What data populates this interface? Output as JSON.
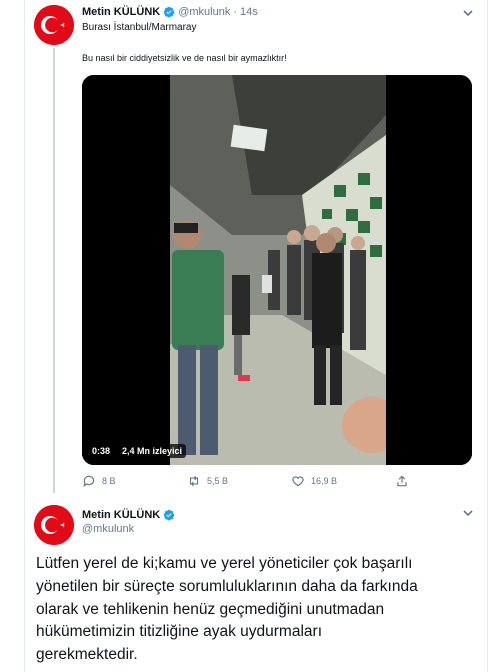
{
  "tweet1": {
    "author_name": "Metin KÜLÜNK",
    "handle": "@mkulunk",
    "separator": "·",
    "time": "14s",
    "location": "Burası İstanbul/Marmaray",
    "text": "Bu nasıl bir ciddiyetsizlik ve de nasıl bir aymazlıktır!",
    "video": {
      "duration": "0:38",
      "views": "2,4 Mn izleyici"
    },
    "actions": {
      "reply_count": "8 B",
      "retweet_count": "5,5 B",
      "like_count": "16,9 B"
    }
  },
  "tweet2": {
    "author_name": "Metin KÜLÜNK",
    "handle": "@mkulunk",
    "text": "Lütfen yerel de ki;kamu ve yerel yöneticiler çok başarılı\nyönetilen bir süreçte sorumluluklarının daha da farkında\nolarak ve tehlikenin henüz geçmediğini unutmadan\nhükümetimizin titizliğine ayak uydurmaları\ngerekmektedir."
  },
  "colors": {
    "avatar_bg": "#e30a17",
    "verified": "#1da1f2",
    "muted": "#657786"
  },
  "icons": [
    "turkish-flag-avatar",
    "verified-badge-icon",
    "chevron-down-icon",
    "reply-icon",
    "retweet-icon",
    "like-icon",
    "share-icon"
  ]
}
